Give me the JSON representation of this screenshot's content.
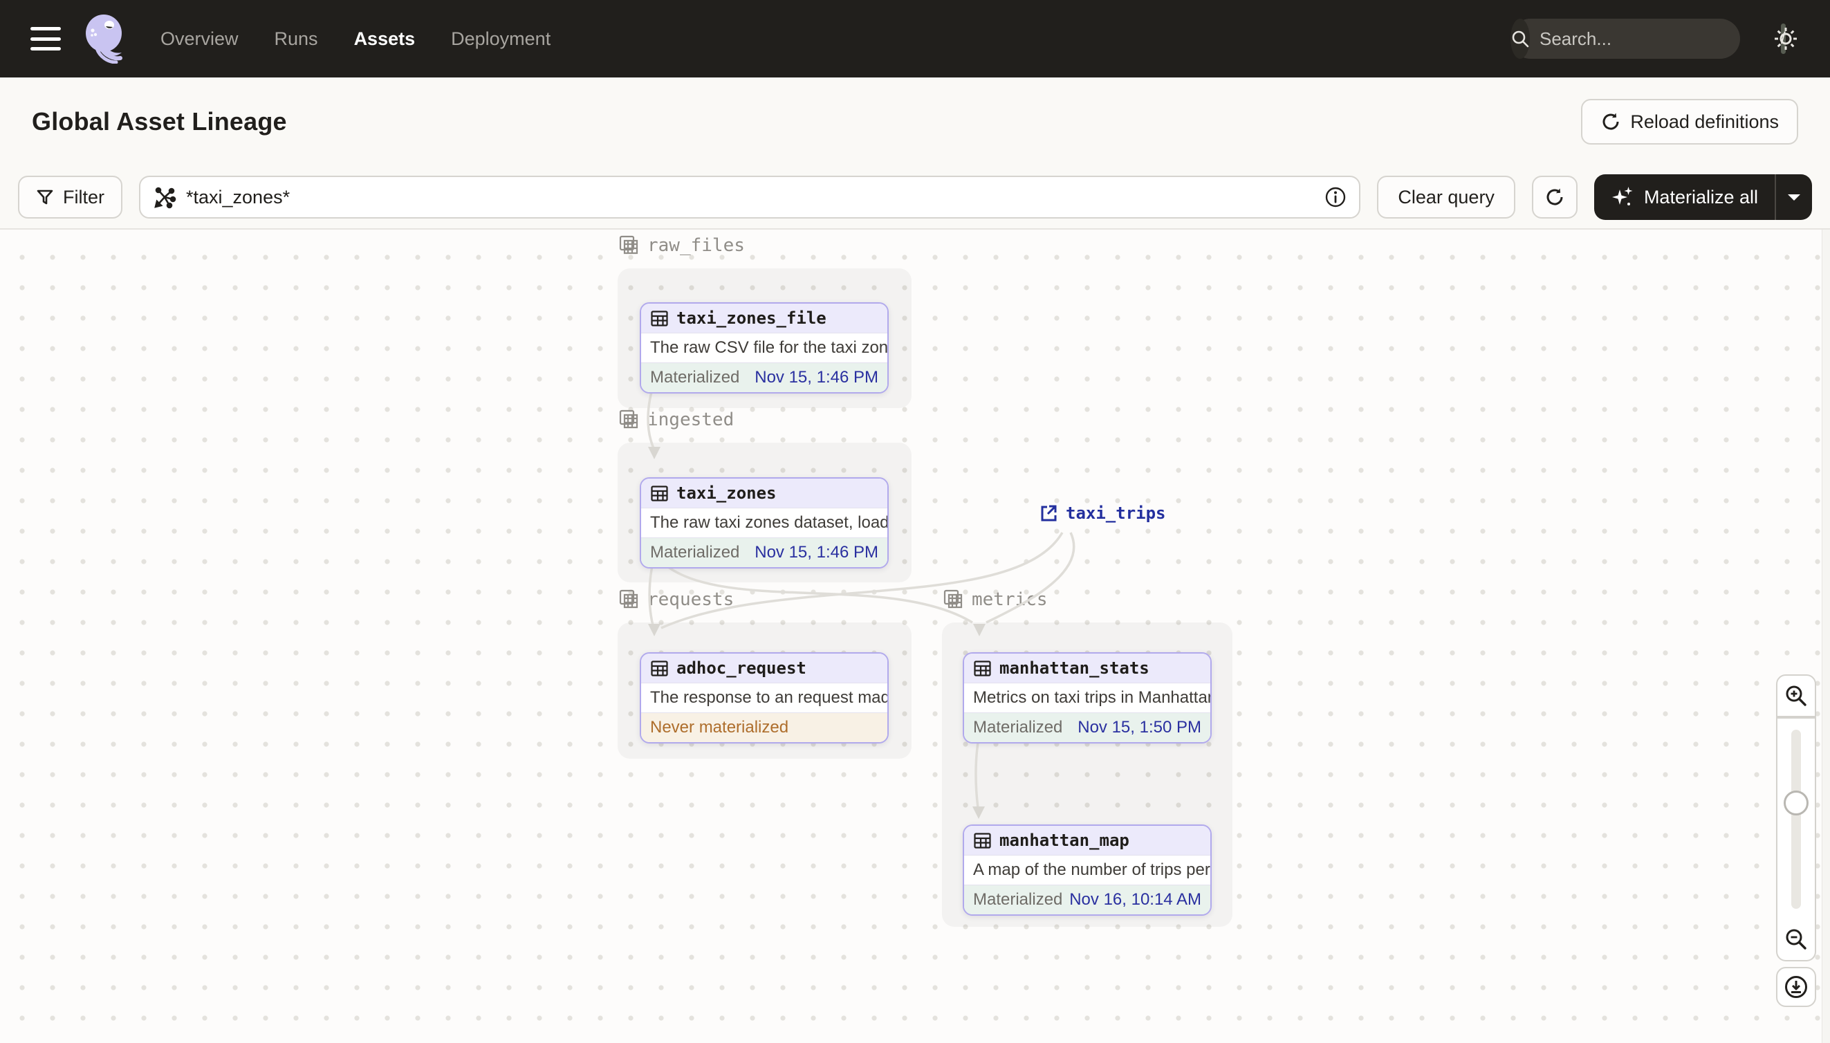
{
  "nav": {
    "items": [
      {
        "label": "Overview",
        "active": false
      },
      {
        "label": "Runs",
        "active": false
      },
      {
        "label": "Assets",
        "active": true
      },
      {
        "label": "Deployment",
        "active": false
      }
    ],
    "search_placeholder": "Search...",
    "search_shortcut": "/"
  },
  "header": {
    "title": "Global Asset Lineage",
    "reload_button": "Reload definitions"
  },
  "toolbar": {
    "filter_label": "Filter",
    "query_value": "*taxi_zones*",
    "clear_button": "Clear query",
    "materialize_button": "Materialize all"
  },
  "graph": {
    "groups": [
      {
        "name": "raw_files"
      },
      {
        "name": "ingested"
      },
      {
        "name": "requests"
      },
      {
        "name": "metrics"
      }
    ],
    "nodes": [
      {
        "name": "taxi_zones_file",
        "description": "The raw CSV file for the taxi zones dat...",
        "status": "Materialized",
        "timestamp": "Nov 15, 1:46 PM"
      },
      {
        "name": "taxi_zones",
        "description": "The raw taxi zones dataset, loaded int...",
        "status": "Materialized",
        "timestamp": "Nov 15, 1:46 PM"
      },
      {
        "name": "adhoc_request",
        "description": "The response to an request made in th...",
        "status": "Never materialized",
        "timestamp": ""
      },
      {
        "name": "manhattan_stats",
        "description": "Metrics on taxi trips in Manhattan",
        "status": "Materialized",
        "timestamp": "Nov 15, 1:50 PM"
      },
      {
        "name": "manhattan_map",
        "description": "A map of the number of trips per taxi z...",
        "status": "Materialized",
        "timestamp": "Nov 16, 10:14 AM"
      }
    ],
    "external_asset": {
      "name": "taxi_trips"
    }
  },
  "colors": {
    "nav_bg": "#211F1C",
    "accent_purple": "#B1A9EC",
    "node_header_bg": "#ECEAFB",
    "materialized_bg": "#E9F2ED",
    "materialized_time": "#2A30A0",
    "never_materialized_text": "#AE6E2C",
    "never_materialized_bg": "#F8F1E5",
    "edge": "#DFDDD8"
  }
}
